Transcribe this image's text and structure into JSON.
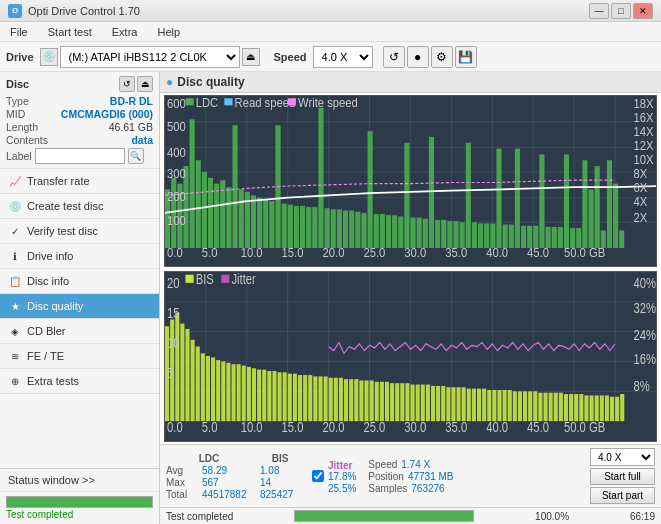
{
  "app": {
    "title": "Opti Drive Control 1.70",
    "icon": "O"
  },
  "titlebar": {
    "minimize": "—",
    "maximize": "□",
    "close": "✕"
  },
  "menubar": {
    "items": [
      "File",
      "Start test",
      "Extra",
      "Help"
    ]
  },
  "drivebar": {
    "drive_label": "Drive",
    "drive_value": "(M:)  ATAPI iHBS112  2 CL0K",
    "eject_icon": "⏏",
    "speed_label": "Speed",
    "speed_value": "4.0 X",
    "icon1": "↺",
    "icon2": "●",
    "icon3": "⚙",
    "icon4": "💾"
  },
  "disc": {
    "label": "Disc",
    "type_label": "Type",
    "type_value": "BD-R DL",
    "mid_label": "MID",
    "mid_value": "CMCMAGDI6 (000)",
    "length_label": "Length",
    "length_value": "46.61 GB",
    "contents_label": "Contents",
    "contents_value": "data",
    "label_label": "Label",
    "label_input_value": "",
    "label_placeholder": ""
  },
  "nav": {
    "items": [
      {
        "id": "transfer-rate",
        "label": "Transfer rate",
        "icon": "📈"
      },
      {
        "id": "create-test-disc",
        "label": "Create test disc",
        "icon": "💿"
      },
      {
        "id": "verify-test-disc",
        "label": "Verify test disc",
        "icon": "✓"
      },
      {
        "id": "drive-info",
        "label": "Drive info",
        "icon": "ℹ"
      },
      {
        "id": "disc-info",
        "label": "Disc info",
        "icon": "📋"
      },
      {
        "id": "disc-quality",
        "label": "Disc quality",
        "icon": "★",
        "active": true
      },
      {
        "id": "cd-bler",
        "label": "CD Bler",
        "icon": "◈"
      },
      {
        "id": "fe-te",
        "label": "FE / TE",
        "icon": "≋"
      },
      {
        "id": "extra-tests",
        "label": "Extra tests",
        "icon": "⊕"
      }
    ]
  },
  "status_window": {
    "label": "Status window >> "
  },
  "sidebar_progress": {
    "value": 100,
    "text": "Test completed"
  },
  "chart_header": {
    "icon": "●",
    "title": "Disc quality"
  },
  "top_chart": {
    "legend": [
      {
        "color": "#4caf50",
        "label": "LDC"
      },
      {
        "color": "#60c0ff",
        "label": "Read speed"
      },
      {
        "color": "#ff80ff",
        "label": "Write speed"
      }
    ],
    "y_max": 600,
    "y_labels_left": [
      "600",
      "500",
      "400",
      "300",
      "200",
      "100",
      "0.0"
    ],
    "y_labels_right": [
      "18X",
      "16X",
      "14X",
      "12X",
      "10X",
      "8X",
      "6X",
      "4X",
      "2X"
    ],
    "x_labels": [
      "0.0",
      "5.0",
      "10.0",
      "15.0",
      "20.0",
      "25.0",
      "30.0",
      "35.0",
      "40.0",
      "45.0",
      "50.0 GB"
    ]
  },
  "bottom_chart": {
    "legend": [
      {
        "color": "#c8e840",
        "label": "BIS"
      },
      {
        "color": "#c050c0",
        "label": "Jitter"
      }
    ],
    "y_labels_left": [
      "20",
      "15",
      "10",
      "5"
    ],
    "y_labels_right": [
      "40%",
      "32%",
      "24%",
      "16%",
      "8%"
    ],
    "x_labels": [
      "0.0",
      "5.0",
      "10.0",
      "15.0",
      "20.0",
      "25.0",
      "30.0",
      "35.0",
      "40.0",
      "45.0",
      "50.0 GB"
    ]
  },
  "stats": {
    "ldc_label": "LDC",
    "bis_label": "BIS",
    "avg_label": "Avg",
    "max_label": "Max",
    "total_label": "Total",
    "ldc_avg": "58.29",
    "ldc_max": "567",
    "ldc_total": "44517882",
    "bis_avg": "1.08",
    "bis_max": "14",
    "bis_total": "825427",
    "jitter_checked": true,
    "jitter_label": "Jitter",
    "jitter_avg": "17.8%",
    "jitter_max": "25.5%",
    "jitter_total": "",
    "speed_label": "Speed",
    "speed_value": "1.74 X",
    "position_label": "Position",
    "position_value": "47731 MB",
    "samples_label": "Samples",
    "samples_value": "763276",
    "speed_select": "4.0 X",
    "start_full_label": "Start full",
    "start_part_label": "Start part"
  },
  "bottom_bar": {
    "text": "Test completed",
    "progress": 100,
    "progress_text": "100.0%",
    "value": "66:19"
  }
}
